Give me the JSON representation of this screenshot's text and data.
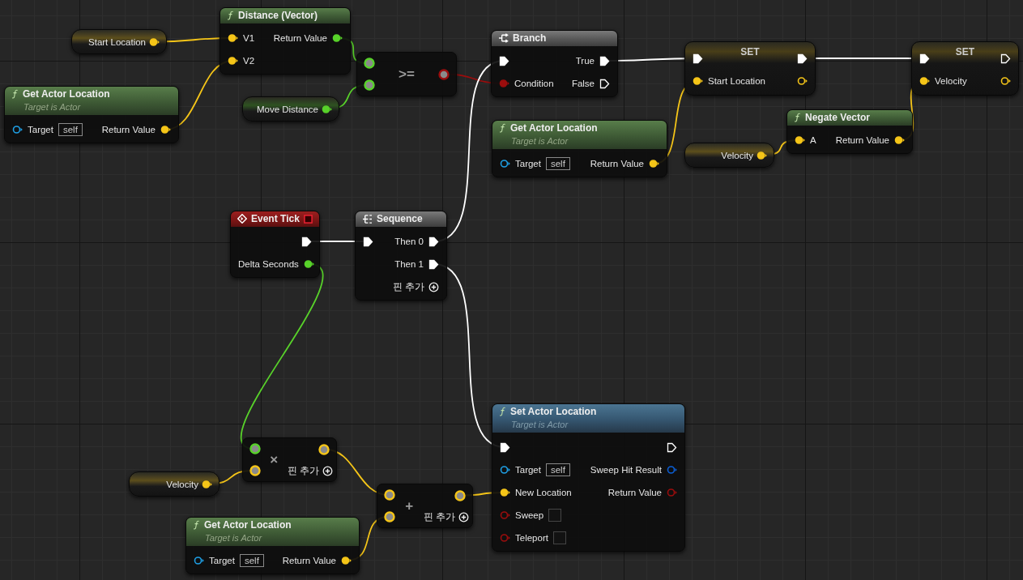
{
  "nodes": [
    {
      "kind": "variable",
      "title": "Start Location",
      "outputs": [
        {
          "color": "#f5c518",
          "connected": true
        }
      ]
    },
    {
      "kind": "pure_function",
      "title": "Distance (Vector)",
      "inputs": [
        {
          "kind": "data",
          "label": "V1",
          "color": "#f5c518",
          "connected": true
        },
        {
          "kind": "data",
          "label": "V2",
          "color": "#f5c518",
          "connected": true
        }
      ],
      "outputs": [
        {
          "kind": "data",
          "label": "Return Value",
          "color": "#58d22a",
          "connected": true
        }
      ]
    },
    {
      "kind": "pure_function",
      "title": "Get Actor Location",
      "subtitle": "Target is Actor",
      "inputs": [
        {
          "kind": "data",
          "label": "Target",
          "color": "#1fa0e6",
          "connected": false,
          "default": "self"
        }
      ],
      "outputs": [
        {
          "kind": "data",
          "label": "Return Value",
          "color": "#f5c518",
          "connected": true
        }
      ]
    },
    {
      "kind": "variable",
      "title": "Move Distance",
      "outputs": [
        {
          "color": "#58d22a",
          "connected": true
        }
      ]
    },
    {
      "kind": "operator",
      "title": ">=",
      "inputs": [
        {
          "color": "#58d22a",
          "connected": true
        },
        {
          "color": "#58d22a",
          "connected": true
        }
      ],
      "outputs": [
        {
          "color": "#9b0d0d",
          "connected": true
        }
      ]
    },
    {
      "kind": "branch",
      "title": "Branch",
      "inputs": [
        {
          "kind": "exec",
          "connected": true
        },
        {
          "kind": "data",
          "label": "Condition",
          "color": "#9b0d0d",
          "connected": true
        }
      ],
      "outputs": [
        {
          "kind": "exec",
          "label": "True",
          "connected": true
        },
        {
          "kind": "exec",
          "label": "False",
          "connected": false
        }
      ]
    },
    {
      "kind": "set",
      "title": "SET",
      "inputs": [
        {
          "kind": "exec",
          "connected": true
        },
        {
          "kind": "data",
          "label": "Start Location",
          "color": "#f5c518",
          "connected": true
        }
      ],
      "outputs": [
        {
          "kind": "exec",
          "connected": true
        },
        {
          "kind": "data",
          "color": "#f5c518",
          "connected": false
        }
      ]
    },
    {
      "kind": "set",
      "title": "SET",
      "inputs": [
        {
          "kind": "exec",
          "connected": true
        },
        {
          "kind": "data",
          "label": "Velocity",
          "color": "#f5c518",
          "connected": true
        }
      ],
      "outputs": [
        {
          "kind": "exec",
          "connected": false
        },
        {
          "kind": "data",
          "color": "#f5c518",
          "connected": false
        }
      ]
    },
    {
      "kind": "pure_function",
      "title": "Get Actor Location",
      "subtitle": "Target is Actor",
      "inputs": [
        {
          "kind": "data",
          "label": "Target",
          "color": "#1fa0e6",
          "connected": false,
          "default": "self"
        }
      ],
      "outputs": [
        {
          "kind": "data",
          "label": "Return Value",
          "color": "#f5c518",
          "connected": true
        }
      ]
    },
    {
      "kind": "pure_function",
      "title": "Negate Vector",
      "inputs": [
        {
          "kind": "data",
          "label": "A",
          "color": "#f5c518",
          "connected": true
        }
      ],
      "outputs": [
        {
          "kind": "data",
          "label": "Return Value",
          "color": "#f5c518",
          "connected": true
        }
      ]
    },
    {
      "kind": "variable",
      "title": "Velocity",
      "outputs": [
        {
          "color": "#f5c518",
          "connected": true
        }
      ]
    },
    {
      "kind": "event",
      "title": "Event Tick",
      "outputs": [
        {
          "kind": "exec",
          "connected": true
        },
        {
          "kind": "data",
          "label": "Delta Seconds",
          "color": "#58d22a",
          "connected": true
        }
      ]
    },
    {
      "kind": "sequence",
      "title": "Sequence",
      "add_pin": "핀 추가",
      "inputs": [
        {
          "kind": "exec",
          "connected": true
        }
      ],
      "outputs": [
        {
          "kind": "exec",
          "label": "Then 0",
          "connected": true
        },
        {
          "kind": "exec",
          "label": "Then 1",
          "connected": true
        }
      ]
    },
    {
      "kind": "operator",
      "title": "×",
      "add_pin": "핀 추가",
      "inputs": [
        {
          "color": "#58d22a",
          "connected": true
        },
        {
          "color": "#f5c518",
          "connected": true
        }
      ],
      "outputs": [
        {
          "color": "#f5c518",
          "connected": true
        }
      ]
    },
    {
      "kind": "variable",
      "title": "Velocity",
      "outputs": [
        {
          "color": "#f5c518",
          "connected": true
        }
      ]
    },
    {
      "kind": "operator",
      "title": "+",
      "add_pin": "핀 추가",
      "inputs": [
        {
          "color": "#f5c518",
          "connected": true
        },
        {
          "color": "#f5c518",
          "connected": true
        }
      ],
      "outputs": [
        {
          "color": "#f5c518",
          "connected": true
        }
      ]
    },
    {
      "kind": "pure_function",
      "title": "Get Actor Location",
      "subtitle": "Target is Actor",
      "inputs": [
        {
          "kind": "data",
          "label": "Target",
          "color": "#1fa0e6",
          "connected": false,
          "default": "self"
        }
      ],
      "outputs": [
        {
          "kind": "data",
          "label": "Return Value",
          "color": "#f5c518",
          "connected": true
        }
      ]
    },
    {
      "kind": "function",
      "title": "Set Actor Location",
      "subtitle": "Target is Actor",
      "inputs": [
        {
          "kind": "exec",
          "connected": true
        },
        {
          "kind": "data",
          "label": "Target",
          "color": "#1fa0e6",
          "connected": false,
          "default": "self"
        },
        {
          "kind": "data",
          "label": "New Location",
          "color": "#f5c518",
          "connected": true
        },
        {
          "kind": "data",
          "label": "Sweep",
          "color": "#9b0d0d",
          "connected": false,
          "checked": false
        },
        {
          "kind": "data",
          "label": "Teleport",
          "color": "#9b0d0d",
          "connected": false,
          "checked": false
        }
      ],
      "outputs": [
        {
          "kind": "exec",
          "connected": false
        },
        {
          "kind": "data",
          "label": "Sweep Hit Result",
          "color": "#0c5fd6",
          "connected": false
        },
        {
          "kind": "data",
          "label": "Return Value",
          "color": "#9b0d0d",
          "connected": false
        }
      ]
    }
  ]
}
